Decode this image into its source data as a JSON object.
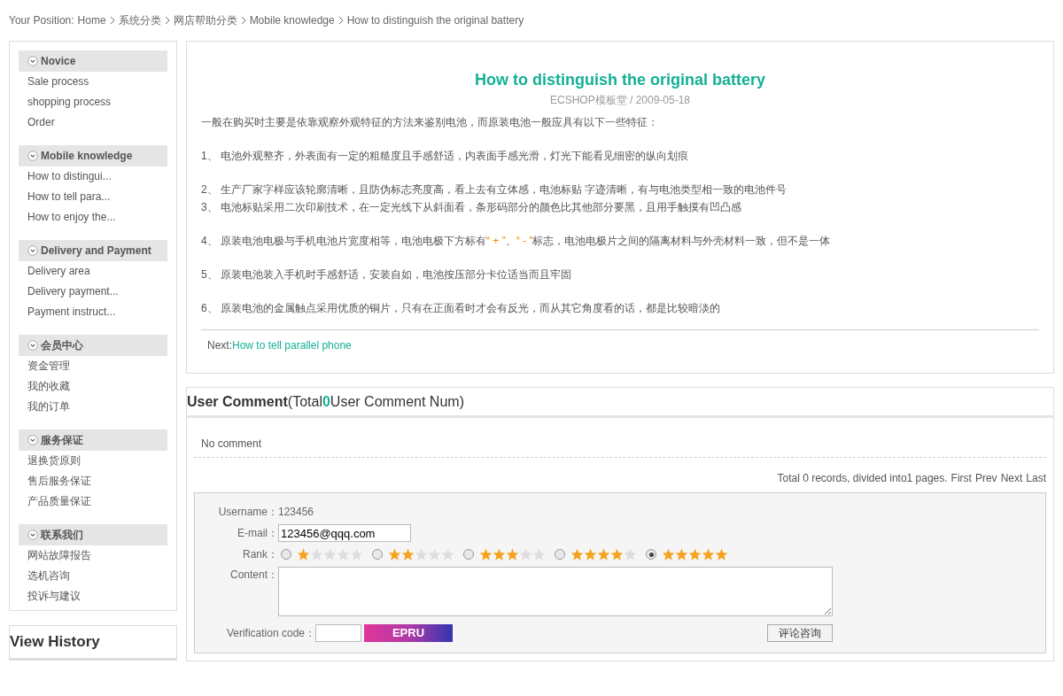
{
  "breadcrumb": {
    "label": "Your Position:",
    "items": [
      "Home",
      "系统分类",
      "网店帮助分类",
      "Mobile knowledge",
      "How to distinguish the original battery"
    ]
  },
  "sidebar": {
    "groups": [
      {
        "title": "Novice",
        "items": [
          "Sale process",
          "shopping process",
          "Order"
        ]
      },
      {
        "title": "Mobile knowledge",
        "items": [
          "How to distingui...",
          "How to tell para...",
          "How to enjoy the..."
        ]
      },
      {
        "title": "Delivery and Payment",
        "items": [
          "Delivery area",
          "Delivery payment...",
          "Payment instruct..."
        ]
      },
      {
        "title": "会员中心",
        "items": [
          "资金管理",
          "我的收藏",
          "我的订单"
        ]
      },
      {
        "title": "服务保证",
        "items": [
          "退换货原则",
          "售后服务保证",
          "产品质量保证"
        ]
      },
      {
        "title": "联系我们",
        "items": [
          "网站故障报告",
          "选机咨询",
          "投诉与建议"
        ]
      }
    ],
    "history_title": "View History"
  },
  "article": {
    "title": "How to distinguish the original battery",
    "meta": "ECSHOP模板堂 / 2009-05-18",
    "sections": [
      [
        {
          "segments": [
            {
              "kind": "plain",
              "text": "一般在购买时主要是依靠观察外观特征的方法来鉴别电池，而原装电池一般应具有以下一些特征："
            }
          ]
        }
      ],
      [
        {
          "segments": [
            {
              "kind": "plain",
              "text": "1、 电池外观整齐，外表面有一定的粗糙度且手感舒适，内表面手感光滑，灯光下能看见细密的纵向划痕"
            }
          ]
        }
      ],
      [
        {
          "segments": [
            {
              "kind": "plain",
              "text": "2、 生产厂家字样应该轮廓清晰，且防伪标志亮度高，看上去有立体感，电池标贴 字迹清晰，有与电池类型相一致的电池件号"
            }
          ]
        },
        {
          "segments": [
            {
              "kind": "plain",
              "text": "3、 电池标贴采用二次印刷技术，在一定光线下从斜面看，条形码部分的颜色比其他部分要黑，且用手触摸有凹凸感"
            }
          ]
        }
      ],
      [
        {
          "segments": [
            {
              "kind": "plain",
              "text": "4、 原装电池电极与手机电池片宽度相等，电池电极下方标有"
            },
            {
              "kind": "highlight",
              "text": "“ + ”"
            },
            {
              "kind": "plain",
              "text": "、"
            },
            {
              "kind": "highlight",
              "text": "“ - ”"
            },
            {
              "kind": "plain",
              "text": "标志，电池电极片之间的隔离材料与外壳材料一致，但不是一体"
            }
          ]
        }
      ],
      [
        {
          "segments": [
            {
              "kind": "plain",
              "text": "5、 原装电池装入手机时手感舒适，安装自如，电池按压部分卡位适当而且牢固"
            }
          ]
        }
      ],
      [
        {
          "segments": [
            {
              "kind": "plain",
              "text": "6、 原装电池的金属触点采用优质的铜片，只有在正面看时才会有反光，而从其它角度看的话，都是比较暗淡的"
            }
          ]
        }
      ]
    ],
    "next_label": "Next:",
    "next_link": "How to tell parallel phone"
  },
  "comments": {
    "title": "User Comment",
    "count_prefix": "(Total",
    "count": "0",
    "count_suffix": "User Comment Num)",
    "empty": "No comment",
    "pager_text": "Total 0 records, divided into1 pages.",
    "pager_links": [
      "First",
      "Prev",
      "Next",
      "Last"
    ],
    "form": {
      "username_label": "Username：",
      "username": "123456",
      "email_label": "E-mail：",
      "email": "123456@qqq.com",
      "rank_label": "Rank：",
      "ranks": [
        {
          "stars": 1,
          "selected": false
        },
        {
          "stars": 2,
          "selected": false
        },
        {
          "stars": 3,
          "selected": false
        },
        {
          "stars": 4,
          "selected": false
        },
        {
          "stars": 5,
          "selected": true
        }
      ],
      "content_label": "Content：",
      "captcha_label": "Verification code：",
      "captcha_text": "EPRU",
      "submit": "评论咨询"
    }
  }
}
